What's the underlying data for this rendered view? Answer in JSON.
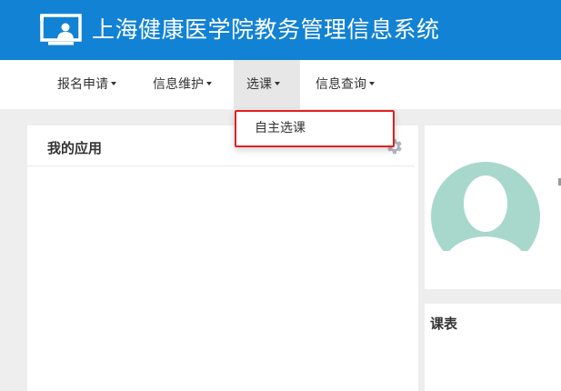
{
  "header": {
    "title": "上海健康医学院教务管理信息系统",
    "logo_icon": "presentation-screen-icon",
    "background": "#1282d4"
  },
  "nav": {
    "items": [
      {
        "label": "报名申请",
        "icon": "caret-down-icon"
      },
      {
        "label": "信息维护",
        "icon": "caret-down-icon"
      },
      {
        "label": "选课",
        "icon": "caret-down-icon",
        "active": true
      },
      {
        "label": "信息查询",
        "icon": "caret-down-icon"
      }
    ]
  },
  "dropdown": {
    "items": [
      {
        "label": "自主选课"
      }
    ],
    "highlight_color": "#e02020"
  },
  "my_apps": {
    "title": "我的应用",
    "icon": "gear-icon"
  },
  "profile": {
    "avatar_icon": "user-avatar-icon",
    "avatar_color": "#a8d8cc"
  },
  "schedule": {
    "title": "课表"
  }
}
